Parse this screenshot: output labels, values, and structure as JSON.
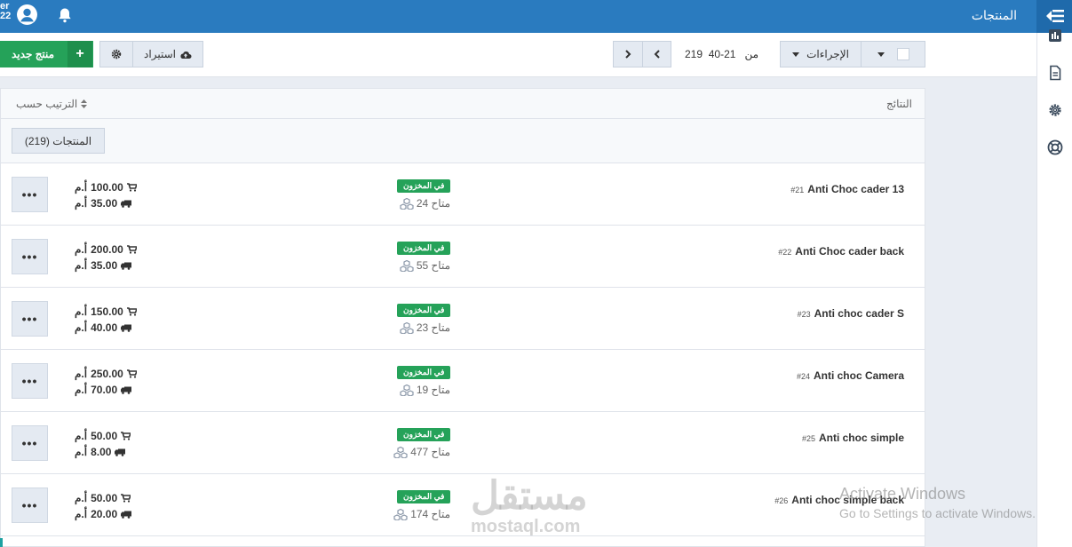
{
  "header": {
    "title": "المنتجات",
    "user_line1": "er",
    "user_line2": "22",
    "icons": [
      "menu-toggle-icon",
      "user-avatar-icon",
      "bell-icon"
    ]
  },
  "rail": {
    "icons": [
      "bar-chart-icon",
      "document-icon",
      "gear-icon",
      "lifebuoy-icon"
    ]
  },
  "toolbar": {
    "new_label": "منتج جديد",
    "import_label": "استيراد",
    "actions_label": "الإجراءات",
    "range": "21-40",
    "of_label": "من",
    "total": "219"
  },
  "panel": {
    "results_label": "النتائج",
    "sort_label": "الترتيب حسب",
    "count_chip": "المنتجات (219)"
  },
  "status_color": "#25a259",
  "rows": [
    {
      "num": "#21",
      "name": "Anti Choc cader 13",
      "badge": "في المخزون",
      "avail": "24 متاح",
      "price": "100.00",
      "ship": "35.00",
      "currency": "أ.م"
    },
    {
      "num": "#22",
      "name": "Anti Choc cader back",
      "badge": "في المخزون",
      "avail": "55 متاح",
      "price": "200.00",
      "ship": "35.00",
      "currency": "أ.م"
    },
    {
      "num": "#23",
      "name": "Anti choc cader S",
      "badge": "في المخزون",
      "avail": "23 متاح",
      "price": "150.00",
      "ship": "40.00",
      "currency": "أ.م"
    },
    {
      "num": "#24",
      "name": "Anti choc Camera",
      "badge": "في المخزون",
      "avail": "19 متاح",
      "price": "250.00",
      "ship": "70.00",
      "currency": "أ.م"
    },
    {
      "num": "#25",
      "name": "Anti choc simple",
      "badge": "في المخزون",
      "avail": "477 متاح",
      "price": "50.00",
      "ship": "8.00",
      "currency": "أ.م"
    },
    {
      "num": "#26",
      "name": "Anti choc simple back",
      "badge": "في المخزون",
      "avail": "174 متاح",
      "price": "50.00",
      "ship": "20.00",
      "currency": "أ.م"
    }
  ],
  "watermark": {
    "logo": "مستقل",
    "url": "mostaql.com"
  },
  "activation": {
    "line1": "Activate Windows",
    "line2": "Go to Settings to activate Windows."
  }
}
